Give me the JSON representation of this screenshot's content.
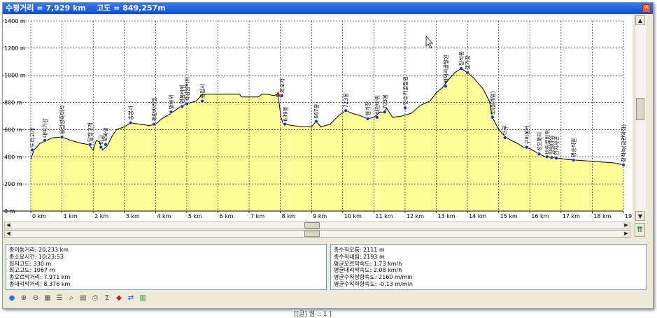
{
  "window": {
    "title": "수평거리 = 7,929 km    고도 = 849,257m",
    "close_glyph": "✕"
  },
  "chart_data": {
    "type": "area",
    "xlabel": "",
    "ylabel": "",
    "x_ticks": [
      "0 km",
      "1 km",
      "2 km",
      "3 km",
      "4 km",
      "5 km",
      "6 km",
      "7 km",
      "8 km",
      "9 km",
      "10 km",
      "11 km",
      "12 km",
      "13 km",
      "14 km",
      "15 km",
      "16 km",
      "17 km",
      "18 km",
      "19"
    ],
    "y_ticks": [
      "0 m",
      "200 m",
      "400 m",
      "600 m",
      "800 m",
      "1000 m",
      "1200 m",
      "1400 m"
    ],
    "xlim": [
      0,
      19
    ],
    "ylim": [
      0,
      1400
    ],
    "fill_color": "#ffff99",
    "line_color": "#000000",
    "grid": true,
    "cursor_marker": {
      "x": 7.929,
      "y": 849
    },
    "profile": [
      [
        0,
        380
      ],
      [
        0.1,
        450
      ],
      [
        0.3,
        500
      ],
      [
        0.5,
        520
      ],
      [
        0.7,
        540
      ],
      [
        1.0,
        545
      ],
      [
        1.3,
        520
      ],
      [
        1.6,
        500
      ],
      [
        1.85,
        490
      ],
      [
        2.0,
        450
      ],
      [
        2.1,
        520
      ],
      [
        2.2,
        510
      ],
      [
        2.3,
        450
      ],
      [
        2.45,
        480
      ],
      [
        2.6,
        550
      ],
      [
        2.75,
        600
      ],
      [
        3.0,
        620
      ],
      [
        3.2,
        650
      ],
      [
        3.5,
        640
      ],
      [
        3.8,
        630
      ],
      [
        4.0,
        640
      ],
      [
        4.2,
        680
      ],
      [
        4.5,
        720
      ],
      [
        4.8,
        770
      ],
      [
        5.0,
        790
      ],
      [
        5.3,
        810
      ],
      [
        5.5,
        860
      ],
      [
        5.9,
        860
      ],
      [
        6.3,
        860
      ],
      [
        6.7,
        860
      ],
      [
        6.75,
        840
      ],
      [
        7.3,
        840
      ],
      [
        7.4,
        860
      ],
      [
        7.6,
        860
      ],
      [
        7.8,
        850
      ],
      [
        7.9,
        860
      ],
      [
        7.95,
        820
      ],
      [
        8.02,
        690
      ],
      [
        8.1,
        640
      ],
      [
        8.4,
        630
      ],
      [
        8.7,
        620
      ],
      [
        9.0,
        620
      ],
      [
        9.15,
        660
      ],
      [
        9.3,
        620
      ],
      [
        9.6,
        640
      ],
      [
        9.9,
        710
      ],
      [
        10.1,
        740
      ],
      [
        10.3,
        720
      ],
      [
        10.6,
        700
      ],
      [
        10.8,
        680
      ],
      [
        11.0,
        690
      ],
      [
        11.2,
        730
      ],
      [
        11.35,
        720
      ],
      [
        11.4,
        760
      ],
      [
        11.6,
        690
      ],
      [
        11.9,
        700
      ],
      [
        12.2,
        720
      ],
      [
        12.5,
        780
      ],
      [
        12.8,
        810
      ],
      [
        13.0,
        870
      ],
      [
        13.2,
        910
      ],
      [
        13.4,
        970
      ],
      [
        13.6,
        1020
      ],
      [
        13.8,
        1050
      ],
      [
        14.0,
        1020
      ],
      [
        14.2,
        980
      ],
      [
        14.5,
        900
      ],
      [
        14.7,
        810
      ],
      [
        14.8,
        690
      ],
      [
        15.0,
        600
      ],
      [
        15.2,
        550
      ],
      [
        15.4,
        520
      ],
      [
        15.6,
        500
      ],
      [
        15.8,
        470
      ],
      [
        16.0,
        460
      ],
      [
        16.3,
        420
      ],
      [
        16.5,
        400
      ],
      [
        16.7,
        395
      ],
      [
        16.9,
        390
      ],
      [
        17.2,
        380
      ],
      [
        17.5,
        375
      ],
      [
        17.8,
        370
      ],
      [
        18.1,
        365
      ],
      [
        18.4,
        360
      ],
      [
        18.7,
        355
      ],
      [
        19.0,
        340
      ]
    ],
    "waypoints": [
      {
        "x": 0.05,
        "y": 450,
        "label": "도리고개"
      },
      {
        "x": 0.45,
        "y": 520,
        "label": "대미기강"
      },
      {
        "x": 1.0,
        "y": 545,
        "label": "용림성흑대석"
      },
      {
        "x": 1.9,
        "y": 490,
        "label": "달팽고개"
      },
      {
        "x": 2.25,
        "y": 470,
        "label": "미금"
      },
      {
        "x": 2.4,
        "y": 490,
        "label": "학바위"
      },
      {
        "x": 3.2,
        "y": 650,
        "label": "송봉가"
      },
      {
        "x": 3.95,
        "y": 640,
        "label": "재판바라일"
      },
      {
        "x": 4.5,
        "y": 730,
        "label": "발바위"
      },
      {
        "x": 4.85,
        "y": 770,
        "label": "병풍바위"
      },
      {
        "x": 5.0,
        "y": 790,
        "label": "흑감암바위"
      },
      {
        "x": 5.5,
        "y": 810,
        "label": "용암사"
      },
      {
        "x": 8.05,
        "y": 850,
        "label": "외오개"
      },
      {
        "x": 8.15,
        "y": 640,
        "label": "639봉"
      },
      {
        "x": 9.15,
        "y": 660,
        "label": "667봉"
      },
      {
        "x": 10.1,
        "y": 740,
        "label": "723봉"
      },
      {
        "x": 10.8,
        "y": 680,
        "label": "헬기장"
      },
      {
        "x": 11.1,
        "y": 690,
        "label": "석천바위"
      },
      {
        "x": 11.35,
        "y": 730,
        "label": "703봉"
      },
      {
        "x": 12.0,
        "y": 760,
        "label": "인수거골탈원"
      },
      {
        "x": 13.3,
        "y": 920,
        "label": "배재리골탈원"
      },
      {
        "x": 13.8,
        "y": 1050,
        "label": "장석봉"
      },
      {
        "x": 14.0,
        "y": 1020,
        "label": "헬기장"
      },
      {
        "x": 14.8,
        "y": 690,
        "label": "모(월계암)"
      },
      {
        "x": 15.2,
        "y": 540,
        "label": "더루"
      },
      {
        "x": 15.9,
        "y": 470,
        "label": "구미봉터"
      },
      {
        "x": 16.3,
        "y": 420,
        "label": "성모봉터"
      },
      {
        "x": 16.55,
        "y": 400,
        "label": "바위골바위"
      },
      {
        "x": 16.7,
        "y": 395,
        "label": "정원바위"
      },
      {
        "x": 16.85,
        "y": 390,
        "label": "인지샤곤"
      },
      {
        "x": 17.4,
        "y": 375,
        "label": "명승석필"
      },
      {
        "x": 19.0,
        "y": 340,
        "label": "장석녹(금련약화)"
      }
    ]
  },
  "stats_left": [
    "총이동거리: 20.233 km",
    "총소요시간: 10:23:53",
    "최저고도: 330 m",
    "최고고도: 1067 m",
    "총오르막거리: 7.971 km",
    "총내리막거리: 8.376 km"
  ],
  "stats_right": [
    "총수직오름: 2111 m",
    "총수직내림: 2193 m",
    "평균오르막속도: 1.73 km/h",
    "평균내리막속도: 2.08 km/h",
    "평균수직상향속도: 2160 m/min",
    "평균수직하향속도: -0.13 m/min"
  ],
  "toolbar": [
    {
      "name": "globe-icon",
      "glyph": "●",
      "color": "#2a7ad0"
    },
    {
      "name": "zoom-in-icon",
      "glyph": "⊕",
      "color": "#444"
    },
    {
      "name": "zoom-out-icon",
      "glyph": "⊖",
      "color": "#444"
    },
    {
      "name": "grid-icon",
      "glyph": "▦",
      "color": "#555"
    },
    {
      "name": "list-icon",
      "glyph": "☰",
      "color": "#555"
    },
    {
      "name": "find-icon",
      "glyph": "⌕",
      "color": "#444"
    },
    {
      "name": "page-icon",
      "glyph": "▤",
      "color": "#555"
    },
    {
      "name": "print-icon",
      "glyph": "⎙",
      "color": "#555"
    },
    {
      "name": "sum-icon",
      "glyph": "Σ",
      "color": "#1a7a1a"
    },
    {
      "name": "marker-icon",
      "glyph": "◆",
      "color": "#b02020"
    },
    {
      "name": "swap-icon",
      "glyph": "⇄",
      "color": "#2050c0"
    },
    {
      "name": "export-icon",
      "glyph": "▥",
      "color": "#2a8a2a"
    }
  ],
  "scroll_glyphs": {
    "up": "▲",
    "down": "▼",
    "left": "◀",
    "right": "▶",
    "collapse": "⇈"
  },
  "bottom_text": "[[글] 웹 :: 1 ]"
}
